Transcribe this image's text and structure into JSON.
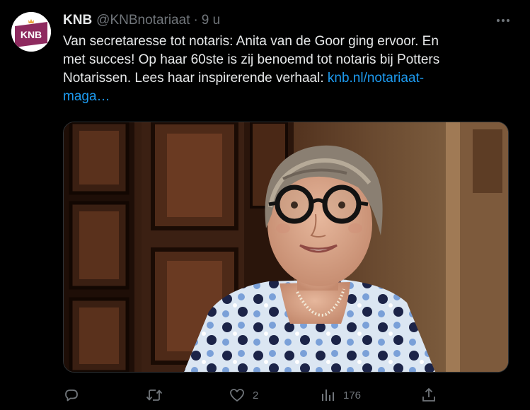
{
  "tweet": {
    "author_name": "KNB",
    "handle": "@KNBnotariaat",
    "separator": "·",
    "time": "9 u",
    "avatar_text": "KNB",
    "text_lines": [
      "Van secretaresse tot notaris: Anita van de Goor ging ervoor. En",
      "met succes! Op haar 60ste is zij benoemd tot notaris bij Potters",
      "Notarissen. Lees haar inspirerende verhaal: "
    ],
    "link_part1": "knb.nl/notariaat-",
    "link_part2": "maga…"
  },
  "actions": {
    "reply_icon": "reply-icon",
    "retweet_icon": "retweet-icon",
    "like_icon": "heart-icon",
    "like_count": "2",
    "views_icon": "bar-chart-icon",
    "views_count": "176",
    "share_icon": "share-icon"
  },
  "colors": {
    "background": "#000000",
    "text": "#e7e9ea",
    "muted": "#71767b",
    "link": "#1d9bf0",
    "brand": "#8e2a5f"
  }
}
